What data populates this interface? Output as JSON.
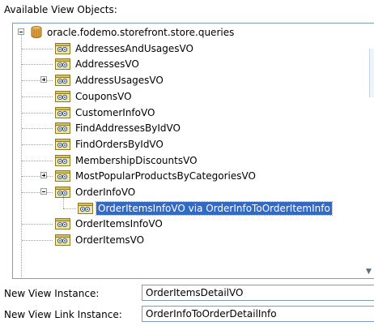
{
  "heading": "Available View Objects:",
  "tree": {
    "root": {
      "label": "oracle.fodemo.storefront.store.queries",
      "icon": "package-icon",
      "expanded": true
    },
    "items": [
      {
        "label": "AddressesAndUsagesVO",
        "icon": "view-object-icon",
        "expander": ""
      },
      {
        "label": "AddressesVO",
        "icon": "view-object-icon",
        "expander": ""
      },
      {
        "label": "AddressUsagesVO",
        "icon": "view-object-icon",
        "expander": "plus"
      },
      {
        "label": "CouponsVO",
        "icon": "view-object-icon",
        "expander": ""
      },
      {
        "label": "CustomerInfoVO",
        "icon": "view-object-icon",
        "expander": ""
      },
      {
        "label": "FindAddressesByIdVO",
        "icon": "view-object-icon",
        "expander": ""
      },
      {
        "label": "FindOrdersByIdVO",
        "icon": "view-object-icon",
        "expander": ""
      },
      {
        "label": "MembershipDiscountsVO",
        "icon": "view-object-icon",
        "expander": ""
      },
      {
        "label": "MostPopularProductsByCategoriesVO",
        "icon": "view-object-icon",
        "expander": "plus"
      },
      {
        "label": "OrderInfoVO",
        "icon": "view-object-icon",
        "expander": "minus"
      },
      {
        "label": "OrderItemsInfoVO via OrderInfoToOrderItemInfo",
        "icon": "view-object-icon",
        "expander": "",
        "child": true,
        "selected": true
      },
      {
        "label": "OrderItemsInfoVO",
        "icon": "view-object-icon",
        "expander": ""
      },
      {
        "label": "OrderItemsVO",
        "icon": "view-object-icon",
        "expander": ""
      }
    ]
  },
  "form": {
    "view_instance_label": "New View Instance:",
    "view_instance_value": "OrderItemsDetailVO",
    "view_link_label": "New View Link Instance:",
    "view_link_value": "OrderInfoToOrderDetailInfo"
  },
  "colors": {
    "selection": "#3169c6",
    "border": "#7f9db9"
  }
}
